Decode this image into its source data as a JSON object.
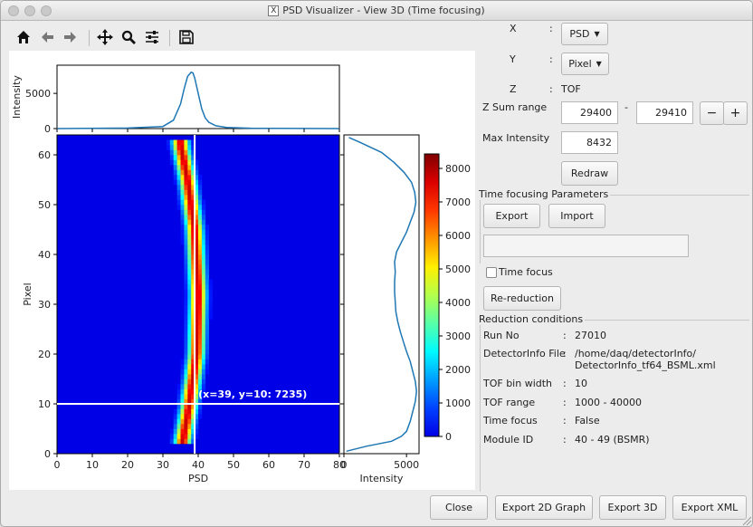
{
  "window": {
    "title": "PSD Visualizer - View 3D (Time focusing)"
  },
  "toolbar": {
    "icons": [
      "home-icon",
      "back-arrow-icon",
      "forward-arrow-icon",
      "pan-move-icon",
      "zoom-magnifier-icon",
      "configure-subplots-icon",
      "save-floppy-icon"
    ]
  },
  "controls": {
    "x_label": "X",
    "y_label": "Y",
    "z_label": "Z",
    "colon": ":",
    "x_value": "PSD",
    "y_value": "Pixel",
    "z_value": "TOF",
    "zsum_label": "Z Sum range",
    "zsum_from": "29400",
    "zsum_dash": "-",
    "zsum_to": "29410",
    "minus": "−",
    "plus": "+",
    "maxint_label": "Max Intensity",
    "maxint_value": "8432",
    "redraw": "Redraw"
  },
  "time_focusing": {
    "title": "Time focusing Parameters",
    "export": "Export",
    "import": "Import",
    "path": "",
    "checkbox_label": "Time focus",
    "checkbox_checked": false,
    "rereduction": "Re-reduction"
  },
  "reduction": {
    "title": "Reduction conditions",
    "rows": [
      {
        "key": "Run No",
        "value": "27010",
        "value2": ""
      },
      {
        "key": "DetectorInfo File",
        "value": "/home/daq/detectorInfo/",
        "value2": "DetectorInfo_tf64_BSML.xml"
      },
      {
        "key": "TOF bin width",
        "value": "10",
        "value2": ""
      },
      {
        "key": "TOF range",
        "value": "1000 - 40000",
        "value2": ""
      },
      {
        "key": "Time focus",
        "value": "False",
        "value2": ""
      },
      {
        "key": "Module ID",
        "value": "40 - 49 (BSMR)",
        "value2": ""
      }
    ]
  },
  "footer": {
    "close": "Close",
    "export2d": "Export 2D Graph",
    "export3d": "Export 3D",
    "exportxml": "Export XML"
  },
  "chart_data": {
    "type": "heatmap",
    "xlabel": "PSD",
    "ylabel": "Pixel",
    "xlim": [
      0,
      80
    ],
    "ylim": [
      0,
      64
    ],
    "xticks": [
      "0",
      "10",
      "20",
      "30",
      "40",
      "50",
      "60",
      "70",
      "80"
    ],
    "yticks": [
      "0",
      "10",
      "20",
      "30",
      "40",
      "50",
      "60"
    ],
    "colorbar": {
      "min": 0,
      "max": 8432,
      "ticks": [
        "0",
        "1000",
        "2000",
        "3000",
        "4000",
        "5000",
        "6000",
        "7000",
        "8000"
      ]
    },
    "cursor": {
      "x": 39,
      "y": 10,
      "label": "(x=39, y=10: 7235)"
    },
    "ridge": {
      "center_at_y": [
        [
          2,
          35.5
        ],
        [
          10,
          37.5
        ],
        [
          20,
          39.5
        ],
        [
          32,
          40.0
        ],
        [
          45,
          39.0
        ],
        [
          55,
          37.0
        ],
        [
          62,
          35.0
        ]
      ],
      "y_range": [
        2,
        62
      ]
    },
    "top_profile": {
      "ylabel": "Intensity",
      "yticks": [
        "0",
        "5000"
      ],
      "ylim": [
        0,
        9000
      ],
      "x": [
        0,
        20,
        30,
        33,
        35,
        36,
        37,
        38,
        38.5,
        39,
        40,
        41,
        42,
        43,
        45,
        48,
        55,
        80
      ],
      "y": [
        0,
        80,
        300,
        1200,
        3500,
        5600,
        7400,
        8000,
        7900,
        7200,
        5000,
        2800,
        1500,
        900,
        400,
        150,
        50,
        0
      ]
    },
    "side_profile": {
      "xlabel": "Intensity",
      "xticks": [
        "0",
        "5000"
      ],
      "xlim": [
        0,
        6000
      ],
      "pixel": [
        0,
        1,
        2,
        3,
        4,
        6,
        8,
        10,
        12,
        14,
        16,
        18,
        20,
        22,
        24,
        26,
        28,
        30,
        32,
        34,
        36,
        38,
        40,
        42,
        44,
        46,
        48,
        50,
        52,
        54,
        56,
        58,
        60,
        62,
        63
      ],
      "intensity": [
        200,
        1800,
        3800,
        4600,
        5000,
        5300,
        5500,
        5700,
        5800,
        5700,
        5500,
        5300,
        5000,
        4750,
        4500,
        4300,
        4150,
        4100,
        4050,
        4050,
        4100,
        4050,
        4200,
        4600,
        5000,
        5300,
        5600,
        5750,
        5650,
        5400,
        4800,
        4000,
        3000,
        1300,
        400
      ]
    }
  }
}
